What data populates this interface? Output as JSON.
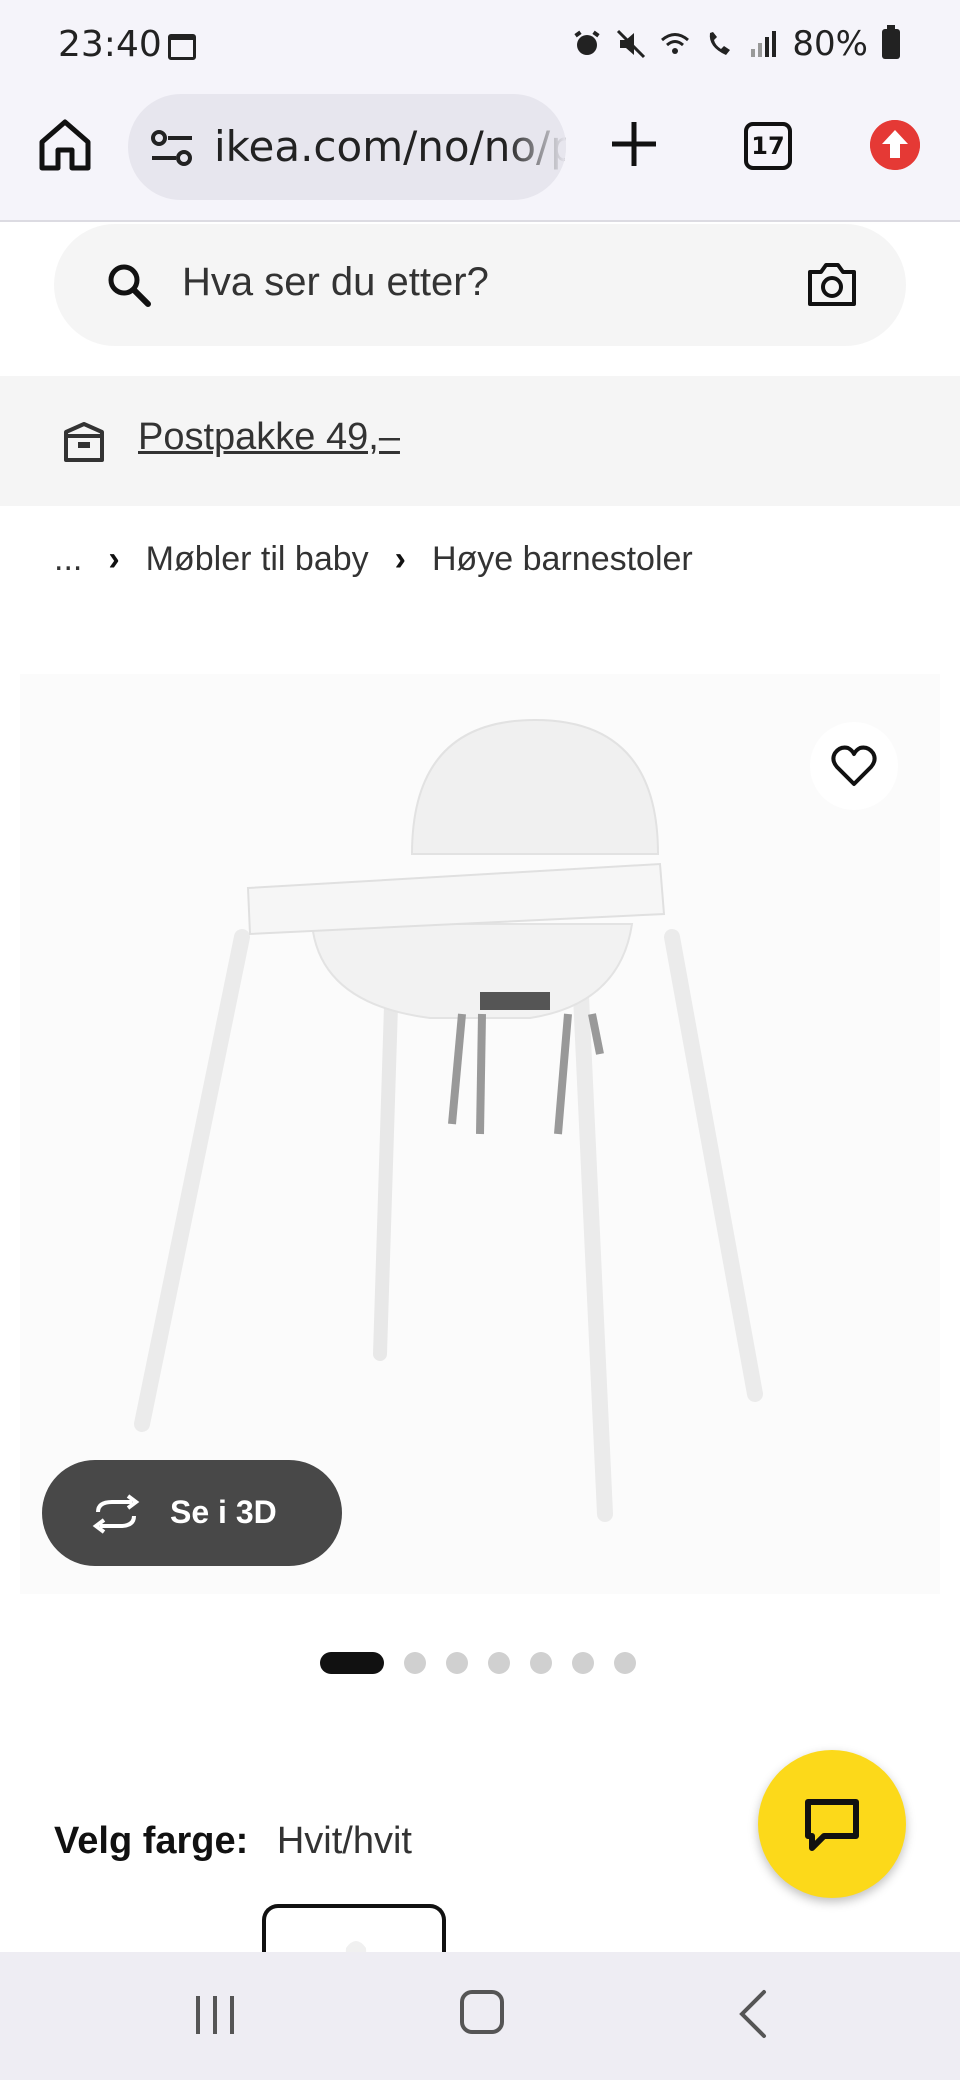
{
  "status_bar": {
    "time": "23:40",
    "battery": "80%"
  },
  "browser": {
    "url": "ikea.com/no/no/p",
    "tab_count": "17"
  },
  "search": {
    "placeholder": "Hva ser du etter?"
  },
  "promo": {
    "text": "Postpakke 49,–"
  },
  "breadcrumb": {
    "ellipsis": "...",
    "items": [
      "Møbler til baby",
      "Høye barnestoler"
    ]
  },
  "product": {
    "view_3d_label": "Se i 3D",
    "image_count": 7,
    "active_image": 1
  },
  "color_picker": {
    "label": "Velg farge:",
    "value": "Hvit/hvit"
  },
  "icons": {
    "home": "home-icon",
    "tune": "site-settings-icon",
    "plus": "new-tab-icon",
    "update": "update-icon",
    "search": "search-icon",
    "camera": "camera-icon",
    "promo": "parcel-icon",
    "favorite": "heart-icon",
    "rotate": "rotate-3d-icon",
    "chat": "chat-icon"
  },
  "colors": {
    "accent_yellow": "#fcd91a",
    "button_dark": "#484848",
    "alert_red": "#e53935"
  }
}
